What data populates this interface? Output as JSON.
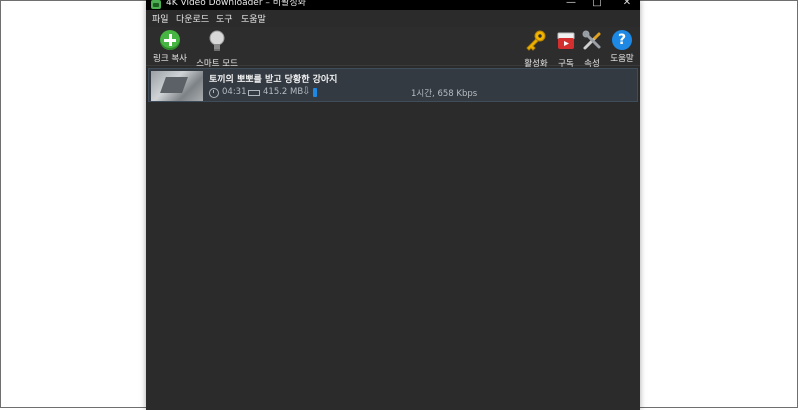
{
  "window": {
    "title": "4K Video Downloader – 비활성화",
    "controls": {
      "minimize": "—",
      "maximize": "□",
      "close": "✕"
    }
  },
  "menu": {
    "file": "파일",
    "download": "다운로드",
    "tools": "도구",
    "help": "도움말"
  },
  "toolbar": {
    "paste_link": "링크 복사",
    "smart_mode": "스마트 모드",
    "activate": "활성화",
    "subscribe": "구독",
    "preferences": "속성",
    "help": "도움말",
    "icons": {
      "paste_link": "plus-circle-icon",
      "smart_mode": "lightbulb-icon",
      "activate": "key-icon",
      "subscribe": "subscription-icon",
      "preferences": "tools-icon",
      "help": "help-icon"
    },
    "colors": {
      "plus": "#46b541",
      "help": "#1e88e5",
      "subscribe": "#d32f2f",
      "key": "#f2b400"
    }
  },
  "downloads": [
    {
      "title": "토끼의 뽀뽀를 받고 당황한 강아지",
      "duration": "04:31",
      "size": "415.2 MB",
      "progress_percent": 3,
      "speed": "1시간, 658 Kbps"
    }
  ],
  "colors": {
    "window_bg": "#2b2b2b",
    "item_bg": "#333a42",
    "progress": "#1e88e5"
  }
}
